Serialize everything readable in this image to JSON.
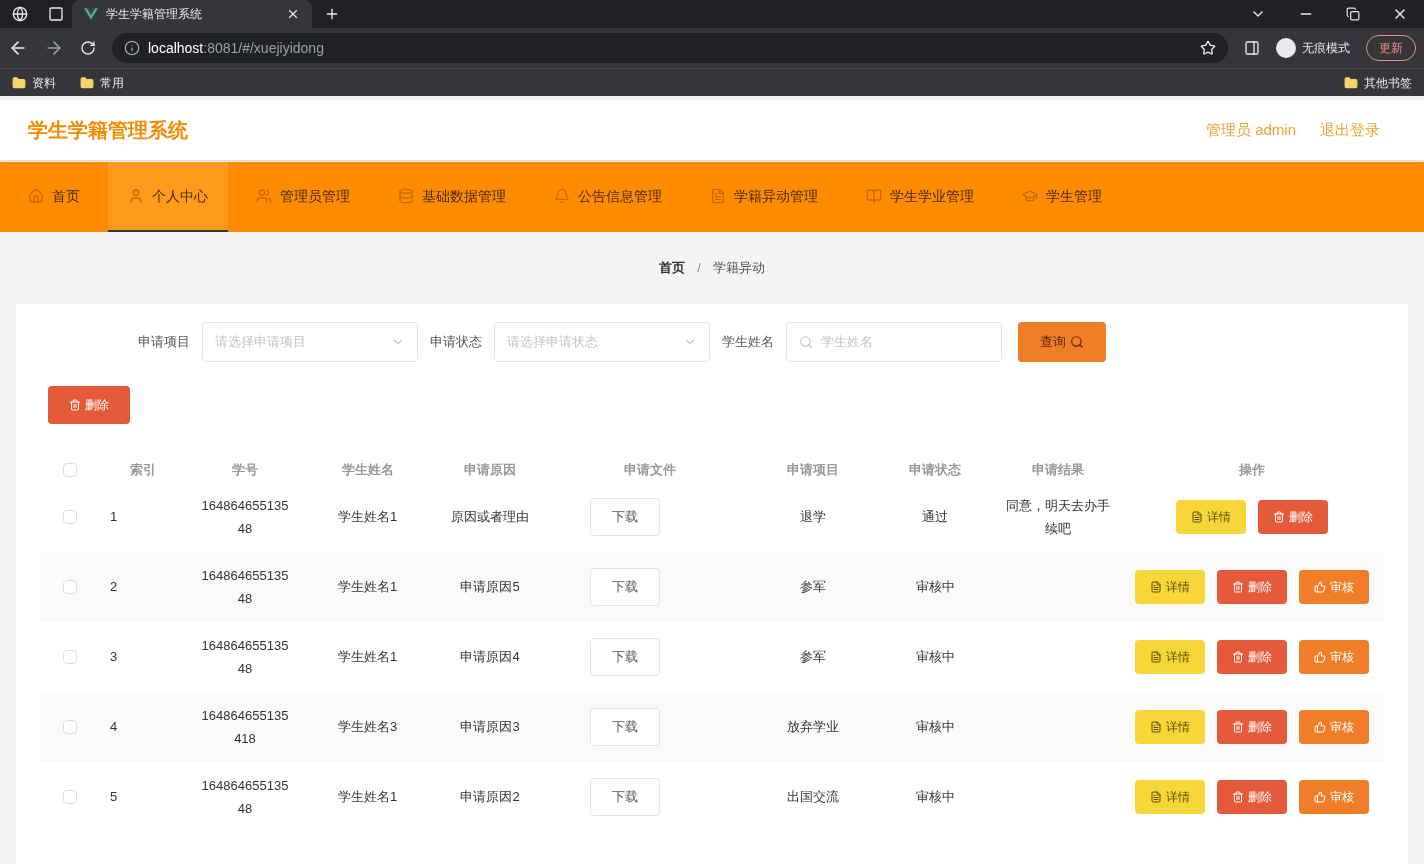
{
  "browser": {
    "tab_title": "学生学籍管理系统",
    "url_host": "localhost",
    "url_rest": ":8081/#/xuejiyidong",
    "profile": "无痕模式",
    "update": "更新",
    "bookmarks": [
      "资料",
      "常用"
    ],
    "other_bookmarks": "其他书签"
  },
  "header": {
    "title": "学生学籍管理系统",
    "user": "管理员 admin",
    "logout": "退出登录"
  },
  "nav": [
    {
      "label": "首页",
      "selected": false
    },
    {
      "label": "个人中心",
      "selected": true
    },
    {
      "label": "管理员管理",
      "selected": false
    },
    {
      "label": "基础数据管理",
      "selected": false
    },
    {
      "label": "公告信息管理",
      "selected": false
    },
    {
      "label": "学籍异动管理",
      "selected": false
    },
    {
      "label": "学生学业管理",
      "selected": false
    },
    {
      "label": "学生管理",
      "selected": false
    }
  ],
  "breadcrumb": [
    "首页",
    "学籍异动"
  ],
  "breadcrumb_separator": "/",
  "filters": [
    {
      "label": "申请项目",
      "placeholder": "请选择申请项目",
      "kind": "select"
    },
    {
      "label": "申请状态",
      "placeholder": "请选择申请状态",
      "kind": "select"
    },
    {
      "label": "学生姓名",
      "placeholder": "学生姓名",
      "kind": "search"
    }
  ],
  "query_button": "查询",
  "delete_button": "删除",
  "table": {
    "all_checked": false,
    "columns": [
      "索引",
      "学号",
      "学生姓名",
      "申请原因",
      "申请文件",
      "申请项目",
      "申请状态",
      "申请结果",
      "操作"
    ],
    "rows": [
      {
        "checked": false,
        "index": "1",
        "student_id": "16486465513548",
        "name": "学生姓名1",
        "reason": "原因或者理由",
        "file": "下载",
        "item": "退学",
        "status": "通过",
        "result": "同意，明天去办手续吧",
        "actions": [
          {
            "label": "详情",
            "kind": "detail"
          },
          {
            "label": "删除",
            "kind": "delete"
          }
        ]
      },
      {
        "checked": false,
        "index": "2",
        "student_id": "16486465513548",
        "name": "学生姓名1",
        "reason": "申请原因5",
        "file": "下载",
        "item": "参军",
        "status": "审核中",
        "actions": [
          {
            "label": "详情",
            "kind": "detail"
          },
          {
            "label": "删除",
            "kind": "delete"
          },
          {
            "label": "审核",
            "kind": "review"
          }
        ]
      },
      {
        "checked": false,
        "index": "3",
        "student_id": "16486465513548",
        "name": "学生姓名1",
        "reason": "申请原因4",
        "file": "下载",
        "item": "参军",
        "status": "审核中",
        "actions": [
          {
            "label": "详情",
            "kind": "detail"
          },
          {
            "label": "删除",
            "kind": "delete"
          },
          {
            "label": "审核",
            "kind": "review"
          }
        ]
      },
      {
        "checked": false,
        "index": "4",
        "student_id": "164864655135418",
        "name": "学生姓名3",
        "reason": "申请原因3",
        "file": "下载",
        "item": "放弃学业",
        "status": "审核中",
        "actions": [
          {
            "label": "详情",
            "kind": "detail"
          },
          {
            "label": "删除",
            "kind": "delete"
          },
          {
            "label": "审核",
            "kind": "review"
          }
        ]
      },
      {
        "checked": false,
        "index": "5",
        "student_id": "16486465513548",
        "name": "学生姓名1",
        "reason": "申请原因2",
        "file": "下载",
        "item": "出国交流",
        "status": "审核中",
        "actions": [
          {
            "label": "详情",
            "kind": "detail"
          },
          {
            "label": "删除",
            "kind": "delete"
          },
          {
            "label": "审核",
            "kind": "review"
          }
        ]
      }
    ]
  }
}
